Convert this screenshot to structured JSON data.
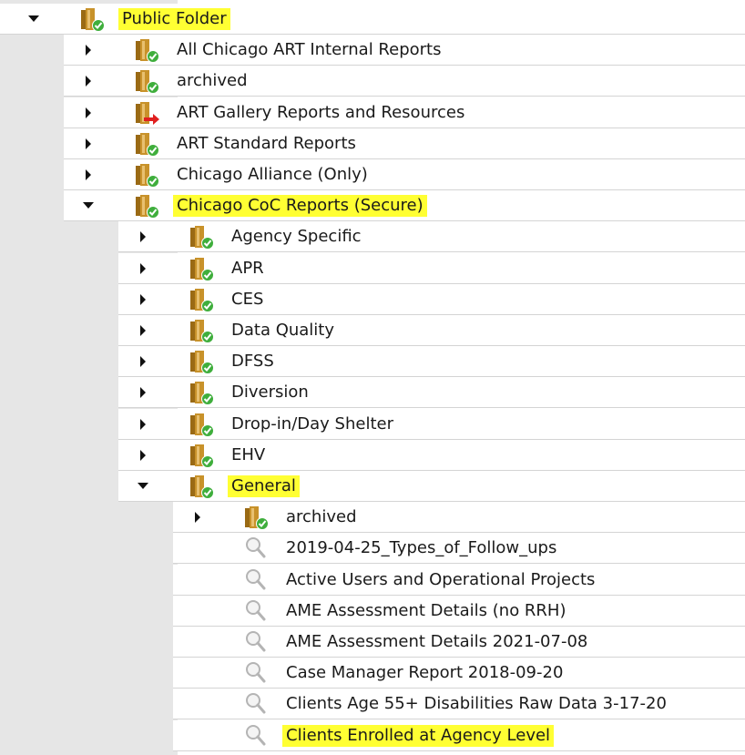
{
  "colors": {
    "highlight": "#ffff33",
    "gutter": "#e6e6e6",
    "row_border": "#d4d4d4",
    "folder": "#c8922a",
    "check": "#3fae3c",
    "shortcut_arrow": "#e02020",
    "magnifier": "#b4b4b4"
  },
  "tree": {
    "root": {
      "label": "Public Folder",
      "state": "expanded",
      "icon": "folder-check-icon",
      "highlighted": true
    },
    "level1": [
      {
        "label": "All Chicago ART Internal Reports",
        "state": "collapsed",
        "icon": "folder-check-icon"
      },
      {
        "label": "archived",
        "state": "collapsed",
        "icon": "folder-check-icon"
      },
      {
        "label": "ART Gallery Reports and Resources",
        "state": "collapsed",
        "icon": "folder-shortcut-icon"
      },
      {
        "label": "ART Standard Reports",
        "state": "collapsed",
        "icon": "folder-check-icon"
      },
      {
        "label": "Chicago Alliance (Only)",
        "state": "collapsed",
        "icon": "folder-check-icon"
      },
      {
        "label": "Chicago CoC Reports (Secure)",
        "state": "expanded",
        "icon": "folder-check-icon",
        "highlighted": true
      }
    ],
    "level2": [
      {
        "label": "Agency Specific",
        "state": "collapsed",
        "icon": "folder-check-icon"
      },
      {
        "label": "APR",
        "state": "collapsed",
        "icon": "folder-check-icon"
      },
      {
        "label": "CES",
        "state": "collapsed",
        "icon": "folder-check-icon"
      },
      {
        "label": "Data Quality",
        "state": "collapsed",
        "icon": "folder-check-icon"
      },
      {
        "label": "DFSS",
        "state": "collapsed",
        "icon": "folder-check-icon"
      },
      {
        "label": "Diversion",
        "state": "collapsed",
        "icon": "folder-check-icon"
      },
      {
        "label": "Drop-in/Day Shelter",
        "state": "collapsed",
        "icon": "folder-check-icon"
      },
      {
        "label": "EHV",
        "state": "collapsed",
        "icon": "folder-check-icon"
      },
      {
        "label": "General",
        "state": "expanded",
        "icon": "folder-check-icon",
        "highlighted": true
      }
    ],
    "level3": [
      {
        "label": "archived",
        "state": "collapsed",
        "icon": "folder-check-icon"
      },
      {
        "label": "2019-04-25_Types_of_Follow_ups",
        "icon": "report-magnifier-icon"
      },
      {
        "label": "Active Users and Operational Projects",
        "icon": "report-magnifier-icon"
      },
      {
        "label": "AME Assessment Details (no RRH)",
        "icon": "report-magnifier-icon"
      },
      {
        "label": "AME Assessment Details 2021-07-08",
        "icon": "report-magnifier-icon"
      },
      {
        "label": "Case Manager Report 2018-09-20",
        "icon": "report-magnifier-icon"
      },
      {
        "label": "Clients Age 55+ Disabilities Raw Data 3-17-20",
        "icon": "report-magnifier-icon"
      },
      {
        "label": "Clients Enrolled at Agency Level",
        "icon": "report-magnifier-icon",
        "highlighted": true
      }
    ]
  }
}
